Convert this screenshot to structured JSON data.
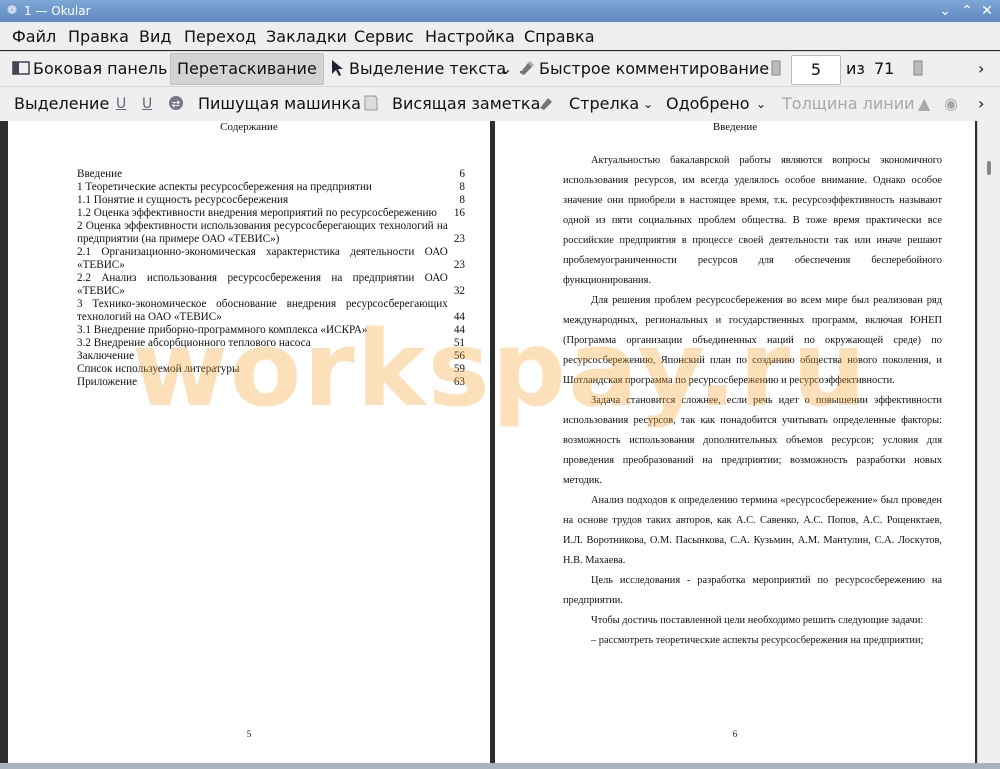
{
  "window": {
    "title": "1 — Okular"
  },
  "menu": [
    "Файл",
    "Правка",
    "Вид",
    "Переход",
    "Закладки",
    "Сервис",
    "Настройка",
    "Справка"
  ],
  "toolbar1": {
    "sidebar": "Боковая панель",
    "drag": "Перетаскивание",
    "text_select": "Выделение текста",
    "quick_comment": "Быстрое комментирование",
    "page_current": "5",
    "page_of": "из",
    "page_total": "71"
  },
  "toolbar2": {
    "selection": "Выделение",
    "typewriter": "Пишущая машинка",
    "sticky_note": "Висящая заметка",
    "arrow": "Стрелка",
    "approved": "Одобрено",
    "line_width": "Толщина линии"
  },
  "left_page": {
    "heading": "Содержание",
    "number": "5",
    "toc": [
      {
        "t": "Введение",
        "n": "6"
      },
      {
        "t": "1 Теоретические аспекты ресурсосбережения на предприятии",
        "n": "8"
      },
      {
        "t": "1.1 Понятие и сущность ресурсосбережения",
        "n": "8"
      },
      {
        "t": "1.2 Оценка эффективности внедрения мероприятий по ресурсосбережению",
        "n": "16"
      },
      {
        "t": "2 Оценка эффективности использования ресурсосберегающих технологий на предприятии (на примере ОАО «ТЕВИС»)",
        "n": "23"
      },
      {
        "t": "2.1 Организационно-экономическая характеристика деятельности ОАО «ТЕВИС»",
        "n": "23"
      },
      {
        "t": "2.2 Анализ использования ресурсосбережения на предприятии ОАО «ТЕВИС»",
        "n": "32"
      },
      {
        "t": "3 Технико-экономическое обоснование внедрения ресурсосберегающих технологий на ОАО «ТЕВИС»",
        "n": "44"
      },
      {
        "t": "3.1 Внедрение приборно-программного комплекса «ИСКРА»",
        "n": "44"
      },
      {
        "t": "3.2 Внедрение абсорбционного теплового насоса",
        "n": "51"
      },
      {
        "t": "Заключение",
        "n": "56"
      },
      {
        "t": "Список используемой литературы",
        "n": "59"
      },
      {
        "t": "Приложение",
        "n": "63"
      }
    ]
  },
  "right_page": {
    "heading": "Введение",
    "number": "6",
    "paragraphs": [
      "Актуальностью бакалаврской работы являются вопросы экономичного использования ресурсов, им всегда уделялось особое внимание. Однако особое значение они приобрели в настоящее время, т.к. ресурсоэффективность называют одной из пяти социальных проблем общества. В тоже время практически все российские предприятия в процессе своей деятельности так или иначе решают проблемуограниченности ресурсов для обеспечения бесперебойного функционирования.",
      "Для решения проблем ресурсосбережения во всем мире был реализован ряд международных, региональных и государственных программ, включая ЮНЕП (Программа организации объединенных наций по окружающей среде) по ресурсосбережению, Японский план по созданию общества нового поколения, и Шотландская программа по ресурсосбережению и ресурсоэффективности.",
      "Задача становится сложнее, если речь идет о повышении эффективности использования ресурсов, так как понадобится учитывать определенные факторы: возможность использования дополнительных объемов ресурсов; условия для проведения преобразований на предприятии; возможность разработки новых методик.",
      "Анализ подходов к определению термина «ресурсосбережение» был проведен на основе трудов таких авторов, как А.С. Савенко, А.С. Попов, А.С. Рощенктаев, И.Л. Воротникова, О.М. Пасынкова, С.А. Кузьмин, А.М. Мантулин, С.А. Лоскутов, Н.В. Махаева.",
      "Цель исследования - разработка мероприятий по ресурсосбережению на предприятии.",
      "Чтобы достичь поставленной цели необходимо решить следующие задачи:",
      "– рассмотреть теоретические аспекты ресурсосбережения на предприятии;"
    ]
  },
  "watermark": "workspay.ru"
}
